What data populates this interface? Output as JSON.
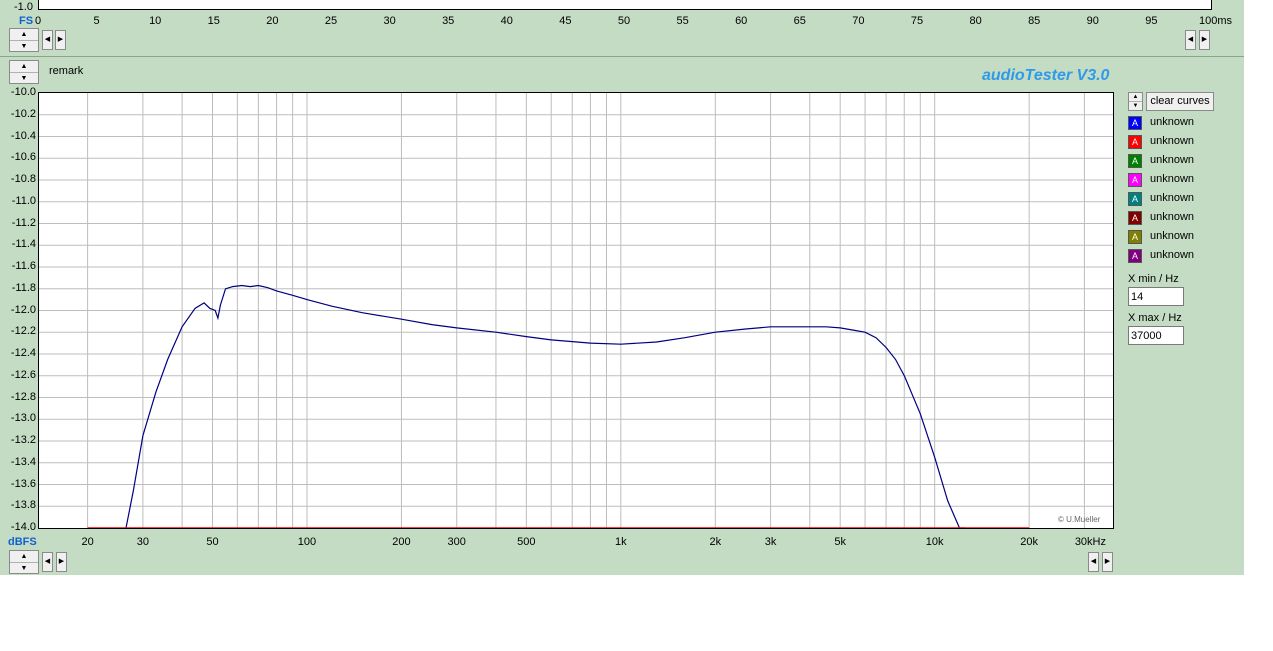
{
  "time_axis": {
    "y_label": "-1.0",
    "fs_label": "FS",
    "ticks": [
      "0",
      "5",
      "10",
      "15",
      "20",
      "25",
      "30",
      "35",
      "40",
      "45",
      "50",
      "55",
      "60",
      "65",
      "70",
      "75",
      "80",
      "85",
      "90",
      "95",
      "100ms"
    ]
  },
  "header": {
    "remark": "remark",
    "brand": "audioTester  V3.0"
  },
  "plot": {
    "y_ticks": [
      "-10.0",
      "-10.2",
      "-10.4",
      "-10.6",
      "-10.8",
      "-11.0",
      "-11.2",
      "-11.4",
      "-11.6",
      "-11.8",
      "-12.0",
      "-12.2",
      "-12.4",
      "-12.6",
      "-12.8",
      "-13.0",
      "-13.2",
      "-13.4",
      "-13.6",
      "-13.8",
      "-14.0"
    ],
    "y_unit": "dBFS",
    "x_ticks": [
      "20",
      "30",
      "50",
      "100",
      "200",
      "300",
      "500",
      "1k",
      "2k",
      "3k",
      "5k",
      "10k",
      "20k",
      "30kHz"
    ],
    "copyright": "© U.Mueller"
  },
  "chart_data": {
    "type": "line",
    "x_scale": "log",
    "xlim": [
      14,
      37000
    ],
    "ylim": [
      -14.0,
      -10.0
    ],
    "ylabel": "dBFS",
    "grid": true,
    "series": [
      {
        "color": "#000080",
        "x": [
          26.5,
          28,
          30,
          33,
          36,
          40,
          44,
          47,
          49,
          51,
          52,
          53,
          55,
          58,
          62,
          66,
          70,
          75,
          80,
          90,
          100,
          120,
          150,
          200,
          250,
          300,
          400,
          500,
          600,
          800,
          1000,
          1300,
          1600,
          2000,
          2500,
          3000,
          3500,
          4000,
          4500,
          5000,
          5500,
          6000,
          6500,
          7000,
          7500,
          8000,
          9000,
          10000,
          11000,
          12000,
          12500
        ],
        "y": [
          -14.0,
          -13.65,
          -13.15,
          -12.75,
          -12.45,
          -12.15,
          -11.98,
          -11.93,
          -11.98,
          -12.0,
          -12.07,
          -11.95,
          -11.8,
          -11.78,
          -11.77,
          -11.78,
          -11.77,
          -11.79,
          -11.82,
          -11.86,
          -11.9,
          -11.96,
          -12.02,
          -12.08,
          -12.13,
          -12.16,
          -12.2,
          -12.24,
          -12.27,
          -12.3,
          -12.31,
          -12.29,
          -12.25,
          -12.2,
          -12.17,
          -12.15,
          -12.15,
          -12.15,
          -12.15,
          -12.16,
          -12.18,
          -12.2,
          -12.25,
          -12.34,
          -12.45,
          -12.6,
          -12.95,
          -13.35,
          -13.75,
          -14.0,
          -14.0
        ]
      },
      {
        "color": "#ff0000",
        "x": [
          20,
          20000
        ],
        "y": [
          -14.0,
          -14.0
        ]
      }
    ]
  },
  "legend": {
    "clear_label": "clear curves",
    "items": [
      {
        "label": "unknown",
        "color": "#0000ff"
      },
      {
        "label": "unknown",
        "color": "#ff0000"
      },
      {
        "label": "unknown",
        "color": "#008000"
      },
      {
        "label": "unknown",
        "color": "#ff00ff"
      },
      {
        "label": "unknown",
        "color": "#008080"
      },
      {
        "label": "unknown",
        "color": "#800000"
      },
      {
        "label": "unknown",
        "color": "#808000"
      },
      {
        "label": "unknown",
        "color": "#800080"
      }
    ],
    "swatch_glyph": "A"
  },
  "controls": {
    "xmin_label": "X min / Hz",
    "xmin_value": "14",
    "xmax_label": "X max / Hz",
    "xmax_value": "37000"
  },
  "glyphs": {
    "up": "▲",
    "down": "▼",
    "left": "◀",
    "right": "▶"
  }
}
